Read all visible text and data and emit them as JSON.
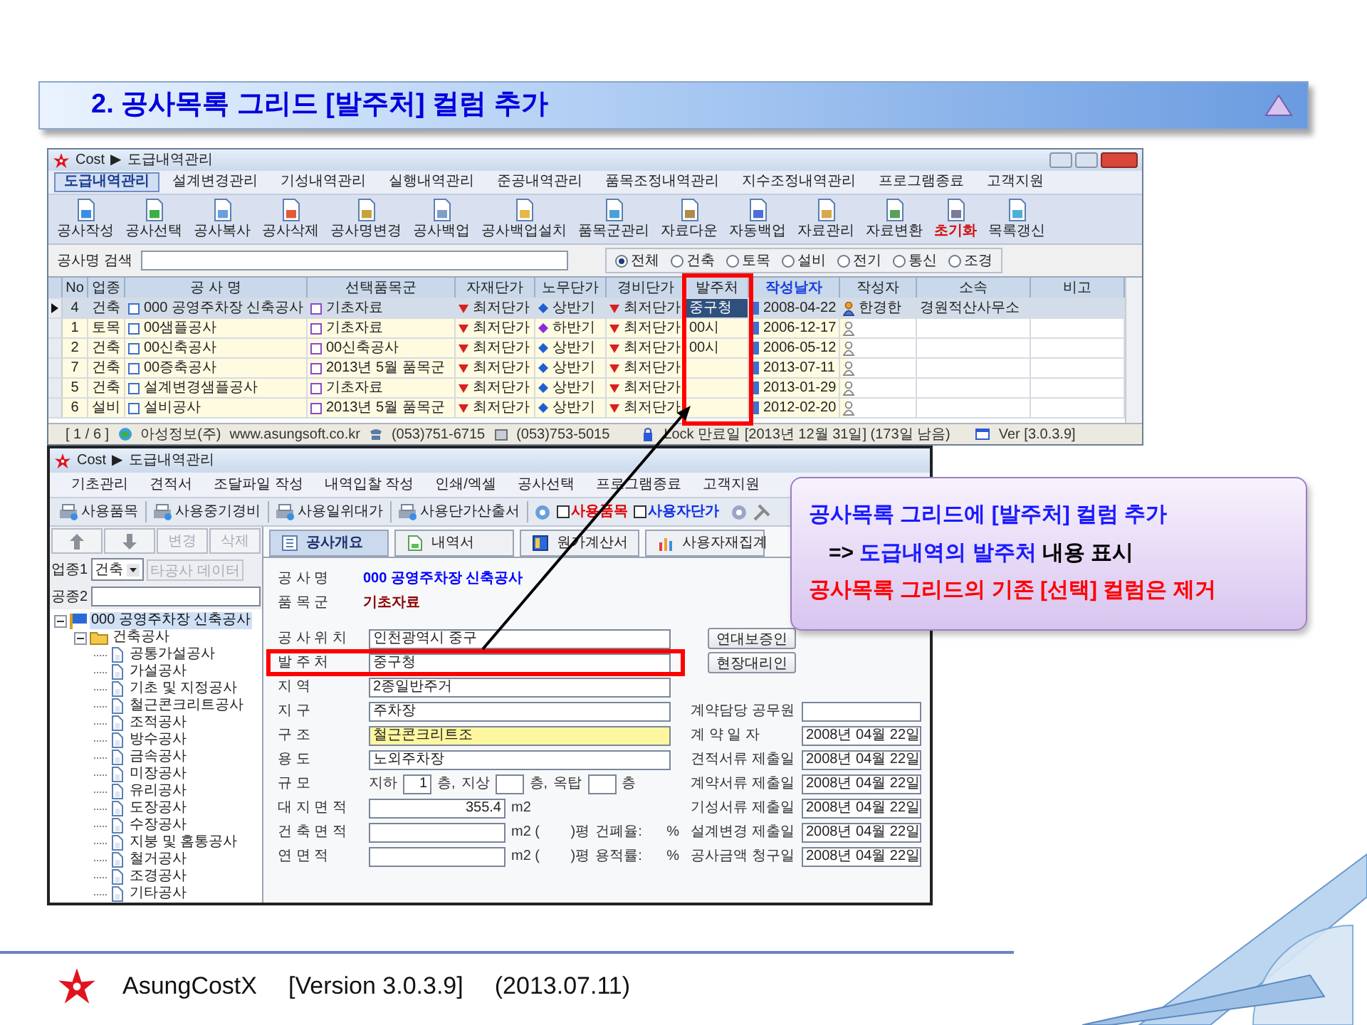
{
  "slide_title": "2. 공사목록 그리드 [발주처] 컬럼 추가",
  "top_window": {
    "title_parts": [
      "Cost",
      "▶",
      "도급내역관리"
    ],
    "menu_tabs": [
      {
        "label": "도급내역관리",
        "selected": true
      },
      {
        "label": "설계변경관리",
        "selected": false
      },
      {
        "label": "기성내역관리",
        "selected": false
      },
      {
        "label": "실행내역관리",
        "selected": false
      },
      {
        "label": "준공내역관리",
        "selected": false
      },
      {
        "label": "품목조정내역관리",
        "selected": false
      },
      {
        "label": "지수조정내역관리",
        "selected": false
      },
      {
        "label": "프로그램종료",
        "selected": false
      },
      {
        "label": "고객지원",
        "selected": false
      }
    ],
    "toolbar": [
      {
        "label": "공사작성",
        "emphasized": false
      },
      {
        "label": "공사선택",
        "emphasized": false
      },
      {
        "label": "공사복사",
        "emphasized": false
      },
      {
        "label": "공사삭제",
        "emphasized": false
      },
      {
        "label": "공사명변경",
        "emphasized": false
      },
      {
        "label": "공사백업",
        "emphasized": false
      },
      {
        "label": "공사백업설치",
        "emphasized": false
      },
      {
        "label": "품목군관리",
        "emphasized": false
      },
      {
        "label": "자료다운",
        "emphasized": false
      },
      {
        "label": "자동백업",
        "emphasized": false
      },
      {
        "label": "자료관리",
        "emphasized": false
      },
      {
        "label": "자료변환",
        "emphasized": false
      },
      {
        "label": "초기화",
        "emphasized": true
      },
      {
        "label": "목록갱신",
        "emphasized": false
      }
    ],
    "search_label": "공사명 검색",
    "filters": [
      {
        "label": "전체",
        "selected": true
      },
      {
        "label": "건축",
        "selected": false
      },
      {
        "label": "토목",
        "selected": false
      },
      {
        "label": "설비",
        "selected": false
      },
      {
        "label": "전기",
        "selected": false
      },
      {
        "label": "통신",
        "selected": false
      },
      {
        "label": "조경",
        "selected": false
      }
    ],
    "columns": [
      {
        "label": "No",
        "sorted": false,
        "highlighted": false
      },
      {
        "label": "업종",
        "sorted": false,
        "highlighted": false
      },
      {
        "label": "공 사 명",
        "sorted": false,
        "highlighted": false
      },
      {
        "label": "선택품목군",
        "sorted": false,
        "highlighted": false
      },
      {
        "label": "자재단가",
        "sorted": false,
        "highlighted": false
      },
      {
        "label": "노무단가",
        "sorted": false,
        "highlighted": false
      },
      {
        "label": "경비단가",
        "sorted": false,
        "highlighted": false
      },
      {
        "label": "발주처",
        "sorted": false,
        "highlighted": true
      },
      {
        "label": "작성날자",
        "sorted": true,
        "highlighted": false
      },
      {
        "label": "작성자",
        "sorted": false,
        "highlighted": false
      },
      {
        "label": "소속",
        "sorted": false,
        "highlighted": false
      },
      {
        "label": "비고",
        "sorted": false,
        "highlighted": false
      }
    ],
    "rows": [
      {
        "selected": true,
        "no": "4",
        "type": "건축",
        "name": "000 공영주차장 신축공사",
        "group": "기초자료",
        "material": "최저단가",
        "labor": "상반기",
        "color": "#1f5fd0",
        "expense": "최저단가",
        "client": "중구청",
        "date": "2008-04-22",
        "author": "한경한",
        "affiliation": "경원적산사무소"
      },
      {
        "selected": false,
        "no": "1",
        "type": "토목",
        "name": "00샘플공사",
        "group": "기초자료",
        "material": "최저단가",
        "labor": "하반기",
        "color": "#8a2ad8",
        "expense": "최저단가",
        "client": "00시",
        "date": "2006-12-17"
      },
      {
        "selected": false,
        "no": "2",
        "type": "건축",
        "name": "00신축공사",
        "group": "00신축공사",
        "material": "최저단가",
        "labor": "상반기",
        "color": "#1f5fd0",
        "expense": "최저단가",
        "client": "00시",
        "date": "2006-05-12"
      },
      {
        "selected": false,
        "no": "7",
        "type": "건축",
        "name": "00증축공사",
        "group": "2013년 5월 품목군",
        "material": "최저단가",
        "labor": "상반기",
        "color": "#1f5fd0",
        "expense": "최저단가",
        "date": "2013-07-11"
      },
      {
        "selected": false,
        "no": "5",
        "type": "건축",
        "name": "설계변경샘플공사",
        "group": "기초자료",
        "material": "최저단가",
        "labor": "상반기",
        "color": "#1f5fd0",
        "expense": "최저단가",
        "date": "2013-01-29"
      },
      {
        "selected": false,
        "no": "6",
        "type": "설비",
        "name": "설비공사",
        "group": "2013년 5월 품목군",
        "material": "최저단가",
        "labor": "상반기",
        "color": "#1f5fd0",
        "expense": "최저단가",
        "date": "2012-02-20"
      }
    ],
    "status": [
      "[ 1 / 6 ]",
      "아성정보(주)",
      "www.asungsoft.co.kr",
      "(053)751-6715",
      "(053)753-5015",
      "Lock 만료일 [2013년 12월 31일] (173일 남음)",
      "Ver [3.0.3.9]"
    ]
  },
  "bottom_window": {
    "title_parts": [
      "Cost",
      "▶",
      "도급내역관리"
    ],
    "menu": [
      "기초관리",
      "견적서",
      "조달파일 작성",
      "내역입찰 작성",
      "인쇄/엑셀",
      "공사선택",
      "프로그램종료",
      "고객지원"
    ],
    "toolbar": [
      {
        "kind": "button",
        "label": "사용품목"
      },
      {
        "kind": "button",
        "label": "사용중기경비"
      },
      {
        "kind": "button",
        "label": "사용일위대가"
      },
      {
        "kind": "button",
        "label": "사용단가산출서"
      },
      {
        "kind": "checkbox",
        "label": "사용품목",
        "checked": false,
        "color": "#e00000"
      },
      {
        "kind": "checkbox",
        "label": "사용자단가",
        "checked": false,
        "color": "#1030e0"
      }
    ],
    "tabs": [
      {
        "label": "공사개요",
        "selected": true
      },
      {
        "label": "내역서",
        "selected": false
      },
      {
        "label": "원가계산서",
        "selected": false
      },
      {
        "label": "사용자재집계",
        "selected": false
      }
    ],
    "side_buttons": [
      {
        "kind": "up",
        "disabled": false
      },
      {
        "kind": "down",
        "disabled": false
      },
      {
        "kind": "text",
        "label": "변경",
        "disabled": true
      },
      {
        "kind": "text",
        "label": "삭제",
        "disabled": true
      }
    ],
    "trade1": {
      "label": "업종1",
      "value": "건축"
    },
    "other_data_button": {
      "label": "타공사 데이터",
      "disabled": true
    },
    "trade2_label": "공종2",
    "tree": [
      {
        "label": "000 공영주차장 신축공사",
        "selected": true,
        "expanded": true,
        "children": [
          {
            "label": "건축공사",
            "selected": false,
            "expanded": true,
            "children": [
              {
                "label": "공통가설공사",
                "selected": false
              },
              {
                "label": "가설공사",
                "selected": false
              },
              {
                "label": "기초 및 지정공사",
                "selected": false
              },
              {
                "label": "철근콘크리트공사",
                "selected": false
              },
              {
                "label": "조적공사",
                "selected": false
              },
              {
                "label": "방수공사",
                "selected": false
              },
              {
                "label": "금속공사",
                "selected": false
              },
              {
                "label": "미장공사",
                "selected": false
              },
              {
                "label": "유리공사",
                "selected": false
              },
              {
                "label": "도장공사",
                "selected": false
              },
              {
                "label": "수장공사",
                "selected": false
              },
              {
                "label": "지붕 및 홈통공사",
                "selected": false
              },
              {
                "label": "철거공사",
                "selected": false
              },
              {
                "label": "조경공사",
                "selected": false
              },
              {
                "label": "기타공사",
                "selected": false
              }
            ]
          }
        ]
      }
    ],
    "info": [
      {
        "label": "공 사 명",
        "value": "000 공영주차장 신축공사",
        "color": "#0000ff"
      },
      {
        "label": "품 목 군",
        "value": "기초자료",
        "color": "#8b0000"
      }
    ],
    "fields": [
      {
        "kind": "input",
        "label": "공 사 위 치",
        "value": "인천광역시 중구",
        "emphasized": false,
        "highlighted": false
      },
      {
        "kind": "input",
        "label": "발 주 처",
        "value": "중구청",
        "emphasized": false,
        "highlighted": true
      },
      {
        "kind": "input",
        "label": "지 역",
        "value": "2종일반주거",
        "emphasized": false,
        "highlighted": false
      },
      {
        "kind": "input",
        "label": "지 구",
        "value": "주차장",
        "emphasized": false,
        "highlighted": false
      },
      {
        "kind": "input",
        "label": "구 조",
        "value": "철근콘크리트조",
        "emphasized": true,
        "highlighted": false
      },
      {
        "kind": "input",
        "label": "용 도",
        "value": "노외주차장",
        "emphasized": false,
        "highlighted": false
      },
      {
        "kind": "floors",
        "label": "규 모",
        "parts": [
          {
            "label": "지하",
            "value": "1",
            "unit": "층,"
          },
          {
            "label": "지상",
            "unit": "층,"
          },
          {
            "label": "옥탑",
            "unit": "층"
          }
        ]
      },
      {
        "kind": "area",
        "label": "대 지 면 적",
        "value": "355.4",
        "unit": "m2"
      },
      {
        "kind": "area_ratio",
        "label": "건 축 면 적",
        "unit": "m2 (",
        "pyeong": ")평",
        "ratio_label": "건폐율:",
        "percent": "%"
      },
      {
        "kind": "area_ratio",
        "label": "연 면 적",
        "unit": "m2 (",
        "pyeong": ")평",
        "ratio_label": "용적률:",
        "percent": "%"
      }
    ],
    "right_buttons": [
      "연대보증인",
      "현장대리인"
    ],
    "dates": [
      {
        "label": "계약담당 공무원"
      },
      {
        "label": "계 약 일 자",
        "value": "2008년 04월 22일"
      },
      {
        "label": "견적서류 제출일",
        "value": "2008년 04월 22일"
      },
      {
        "label": "계약서류 제출일",
        "value": "2008년 04월 22일"
      },
      {
        "label": "기성서류 제출일",
        "value": "2008년 04월 22일"
      },
      {
        "label": "설계변경 제출일",
        "value": "2008년 04월 22일"
      },
      {
        "label": "공사금액 청구일",
        "value": "2008년 04월 22일"
      }
    ]
  },
  "callout": [
    [
      {
        "text": "공사목록 그리드에 [발주처] 컬럼 추가",
        "color": "#1a1aff"
      }
    ],
    [
      {
        "text": "=>",
        "color": "#000000"
      },
      {
        "text": "도급내역의 발주처",
        "color": "#1a1aff"
      },
      {
        "text": "내용 표시",
        "color": "#000000"
      }
    ],
    [
      {
        "text": "공사목록 그리드의 기존 [선택] 컬럼은 제거",
        "color": "#ff0000"
      }
    ]
  ],
  "footer": {
    "product": "AsungCostX",
    "version": "[Version 3.0.3.9]",
    "date": "(2013.07.11)"
  }
}
